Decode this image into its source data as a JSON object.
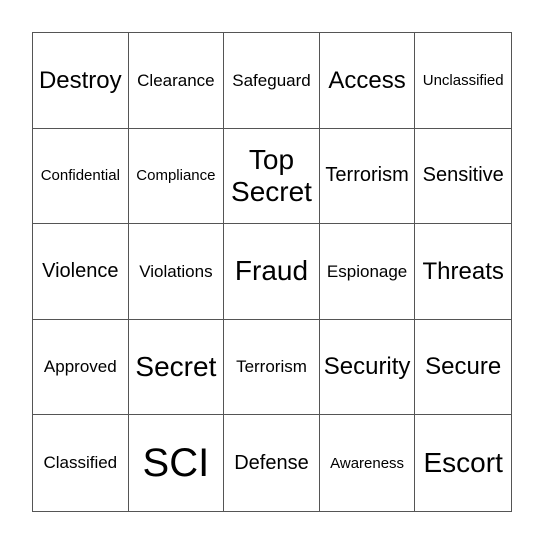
{
  "card": {
    "rows": [
      [
        {
          "text": "Destroy",
          "size": "lg"
        },
        {
          "text": "Clearance",
          "size": "sm"
        },
        {
          "text": "Safeguard",
          "size": "sm"
        },
        {
          "text": "Access",
          "size": "lg"
        },
        {
          "text": "Unclassified",
          "size": "xs"
        }
      ],
      [
        {
          "text": "Confidential",
          "size": "xs"
        },
        {
          "text": "Compliance",
          "size": "xs"
        },
        {
          "text": "Top Secret",
          "size": "xl"
        },
        {
          "text": "Terrorism",
          "size": "md"
        },
        {
          "text": "Sensitive",
          "size": "md"
        }
      ],
      [
        {
          "text": "Violence",
          "size": "md"
        },
        {
          "text": "Violations",
          "size": "sm"
        },
        {
          "text": "Fraud",
          "size": "xl"
        },
        {
          "text": "Espionage",
          "size": "sm"
        },
        {
          "text": "Threats",
          "size": "lg"
        }
      ],
      [
        {
          "text": "Approved",
          "size": "sm"
        },
        {
          "text": "Secret",
          "size": "xl"
        },
        {
          "text": "Terrorism",
          "size": "sm"
        },
        {
          "text": "Security",
          "size": "lg"
        },
        {
          "text": "Secure",
          "size": "lg"
        }
      ],
      [
        {
          "text": "Classified",
          "size": "sm"
        },
        {
          "text": "SCI",
          "size": "xxl"
        },
        {
          "text": "Defense",
          "size": "md"
        },
        {
          "text": "Awareness",
          "size": "xs"
        },
        {
          "text": "Escort",
          "size": "xl"
        }
      ]
    ]
  }
}
